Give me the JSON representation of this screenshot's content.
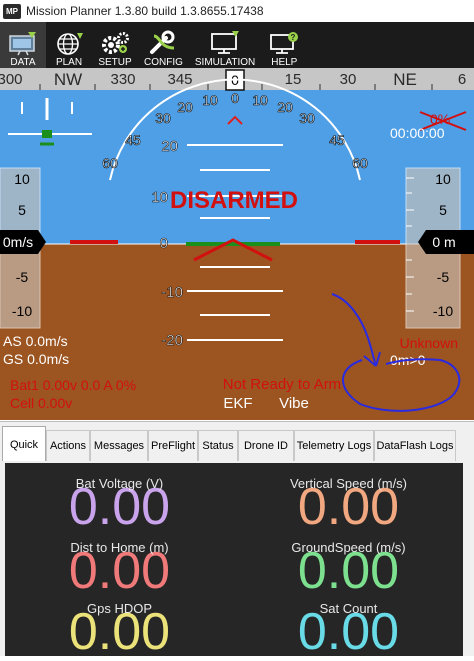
{
  "window": {
    "logo_text": "MP",
    "title": "Mission Planner 1.3.80 build 1.3.8655.17438"
  },
  "menu": [
    {
      "label": "DATA",
      "icon": "data-icon"
    },
    {
      "label": "PLAN",
      "icon": "globe-icon"
    },
    {
      "label": "SETUP",
      "icon": "gears-icon"
    },
    {
      "label": "CONFIG",
      "icon": "wrench-icon"
    },
    {
      "label": "SIMULATION",
      "icon": "monitor-icon"
    },
    {
      "label": "HELP",
      "icon": "help-icon"
    }
  ],
  "hud": {
    "heading_ticks": [
      {
        "label": "300"
      },
      {
        "label": "NW"
      },
      {
        "label": "330"
      },
      {
        "label": "345"
      },
      {
        "label": "0"
      },
      {
        "label": "15"
      },
      {
        "label": "30"
      },
      {
        "label": "NE"
      },
      {
        "label": "6"
      }
    ],
    "roll_labels": [
      "60",
      "45",
      "30",
      "20",
      "10",
      "0",
      "10",
      "20",
      "30",
      "45",
      "60"
    ],
    "pitch_labels": [
      "20",
      "10",
      "0",
      "-10",
      "-20"
    ],
    "left_scale": [
      "10",
      "5",
      "-5",
      "-10"
    ],
    "right_scale": [
      "10",
      "5",
      "-5",
      "-10"
    ],
    "speed_readout": "0m/s",
    "alt_readout": "0 m",
    "battery_pct": "0%",
    "timer": "00:00:00",
    "status_main": "DISARMED",
    "airspeed": "AS 0.0m/s",
    "groundspeed": "GS 0.0m/s",
    "battery_line": "Bat1 0.00v 0.0 A 0%",
    "cell_line": "Cell 0.00v",
    "arm_status": "Not Ready to Arm",
    "ekf": "EKF",
    "vibe": "Vibe",
    "mode": "Unknown",
    "wp_distance": "0m>0",
    "colors": {
      "sky": "#4f9fe6",
      "ground": "#9c5420",
      "warning_red": "#d21010",
      "horizon_green": "#1b8f1b",
      "annotation_blue": "#2a2ae0"
    }
  },
  "tabs": [
    {
      "label": "Quick"
    },
    {
      "label": "Actions"
    },
    {
      "label": "Messages"
    },
    {
      "label": "PreFlight"
    },
    {
      "label": "Status"
    },
    {
      "label": "Drone ID"
    },
    {
      "label": "Telemetry Logs"
    },
    {
      "label": "DataFlash Logs"
    }
  ],
  "quick": [
    {
      "label": "Bat Voltage (V)",
      "value": "0.00",
      "color": "#c9a4ec"
    },
    {
      "label": "Vertical Speed (m/s)",
      "value": "0.00",
      "color": "#f1a780"
    },
    {
      "label": "Dist to Home (m)",
      "value": "0.00",
      "color": "#f07a7a"
    },
    {
      "label": "GroundSpeed (m/s)",
      "value": "0.00",
      "color": "#7ce08e"
    },
    {
      "label": "Gps HDOP",
      "value": "0.00",
      "color": "#ece27a"
    },
    {
      "label": "Sat Count",
      "value": "0.00",
      "color": "#69dbe7"
    }
  ]
}
